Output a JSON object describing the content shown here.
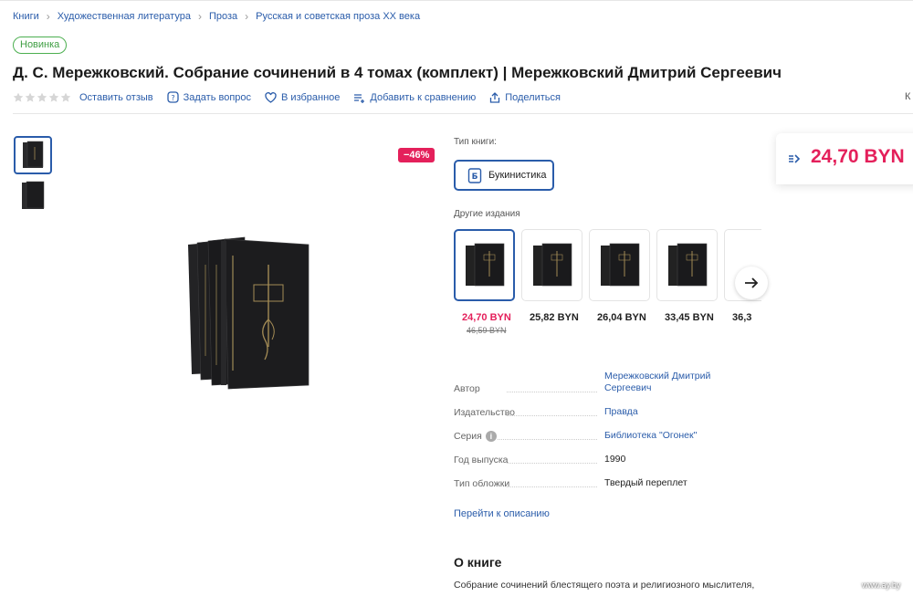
{
  "breadcrumbs": [
    "Книги",
    "Художественная литература",
    "Проза",
    "Русская и советская проза XX века"
  ],
  "badge": "Новинка",
  "product_title": "Д. С. Мережковский. Собрание сочинений в 4 томах (комплект) | Мережковский Дмитрий Сергеевич",
  "rating": {
    "stars": 0,
    "max": 5
  },
  "actions": {
    "review": "Оставить отзыв",
    "question": "Задать вопрос",
    "favorite": "В избранное",
    "compare": "Добавить к сравнению",
    "share": "Поделиться"
  },
  "edge_letter": "К",
  "discount": "−46%",
  "book_type": {
    "label": "Тип книги:",
    "selected": "Букинистика"
  },
  "other_editions": {
    "label": "Другие издания",
    "items": [
      {
        "price": "24,70 BYN",
        "old_price": "46,59 BYN"
      },
      {
        "price": "25,82 BYN"
      },
      {
        "price": "26,04 BYN"
      },
      {
        "price": "33,45 BYN"
      },
      {
        "price": "36,3"
      }
    ]
  },
  "specs": [
    {
      "key": "Автор",
      "value": "Мережковский Дмитрий Сергеевич"
    },
    {
      "key": "Издательство",
      "value": "Правда"
    },
    {
      "key": "Серия",
      "value": "Библиотека \"Огонек\""
    },
    {
      "key": "Год выпуска",
      "value": "1990"
    },
    {
      "key": "Тип обложки",
      "value": "Твердый переплет"
    }
  ],
  "goto_description": "Перейти к описанию",
  "about": {
    "heading": "О книге",
    "text": "Собрание сочинений блестящего поэта и религиозного мыслителя,"
  },
  "price_box": {
    "value": "24,70 BYN"
  },
  "watermark": "www.ay.by",
  "colors": {
    "accent": "#2a5caa",
    "price": "#e4205b",
    "badge": "#4caf50"
  }
}
